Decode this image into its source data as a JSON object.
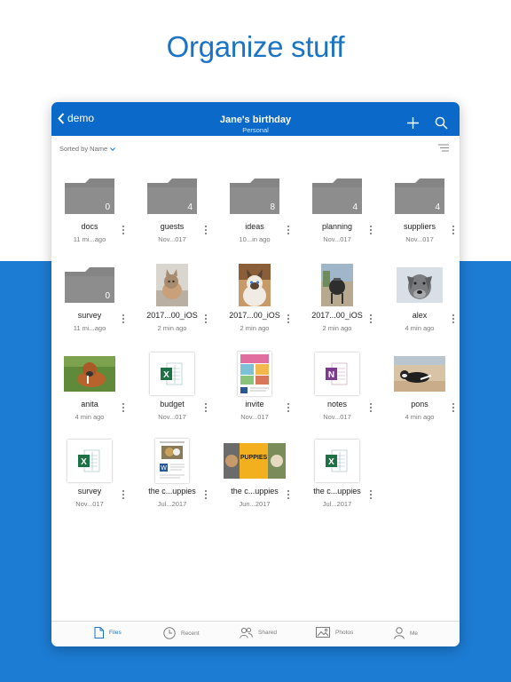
{
  "headline": "Organize stuff",
  "nav": {
    "back_label": "demo",
    "title": "Jane's birthday",
    "subtitle": "Personal",
    "accent": "#0b6ac9"
  },
  "sort": {
    "label": "Sorted by Name"
  },
  "items": [
    {
      "name": "docs",
      "meta": "11 mi...ago",
      "kind": "folder",
      "count": "0"
    },
    {
      "name": "guests",
      "meta": "Nov...017",
      "kind": "folder",
      "count": "4"
    },
    {
      "name": "ideas",
      "meta": "10...in ago",
      "kind": "folder",
      "count": "8"
    },
    {
      "name": "planning",
      "meta": "Nov...017",
      "kind": "folder",
      "count": "4"
    },
    {
      "name": "suppliers",
      "meta": "Nov...017",
      "kind": "folder",
      "count": "4"
    },
    {
      "name": "survey",
      "meta": "11 mi...ago",
      "kind": "folder",
      "count": "0"
    },
    {
      "name": "2017...00_iOS",
      "meta": "2 min ago",
      "kind": "photo-cat1"
    },
    {
      "name": "2017...00_iOS",
      "meta": "2 min ago",
      "kind": "photo-cat2"
    },
    {
      "name": "2017...00_iOS",
      "meta": "2 min ago",
      "kind": "photo-grill"
    },
    {
      "name": "alex",
      "meta": "4 min ago",
      "kind": "photo-dog-gray"
    },
    {
      "name": "anita",
      "meta": "4 min ago",
      "kind": "photo-dog-grass"
    },
    {
      "name": "budget",
      "meta": "Nov...017",
      "kind": "excel"
    },
    {
      "name": "invite",
      "meta": "Nov...017",
      "kind": "flyer"
    },
    {
      "name": "notes",
      "meta": "Nov...017",
      "kind": "onenote"
    },
    {
      "name": "pons",
      "meta": "4 min ago",
      "kind": "photo-dog-beach"
    },
    {
      "name": "survey",
      "meta": "Nov...017",
      "kind": "excel"
    },
    {
      "name": "the c...uppies",
      "meta": "Jul...2017",
      "kind": "word"
    },
    {
      "name": "the c...uppies",
      "meta": "Jun...2017",
      "kind": "puppies-banner",
      "banner_text": "PUPPIES"
    },
    {
      "name": "the c...uppies",
      "meta": "Jul...2017",
      "kind": "excel"
    }
  ],
  "tabs": [
    {
      "label": "Files",
      "icon": "file-icon",
      "active": true
    },
    {
      "label": "Recent",
      "icon": "clock-icon",
      "active": false
    },
    {
      "label": "Shared",
      "icon": "people-icon",
      "active": false
    },
    {
      "label": "Photos",
      "icon": "photo-icon",
      "active": false
    },
    {
      "label": "Me",
      "icon": "person-icon",
      "active": false
    }
  ]
}
